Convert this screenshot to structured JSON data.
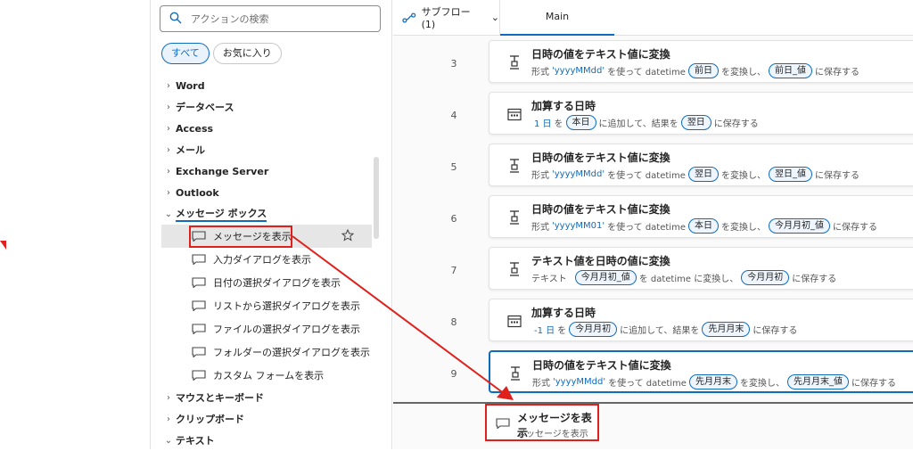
{
  "search": {
    "placeholder": "アクションの検索"
  },
  "filters": [
    {
      "label": "すべて"
    },
    {
      "label": "お気に入り"
    }
  ],
  "tree": {
    "top_categories": [
      "Word",
      "データベース",
      "Access",
      "メール",
      "Exchange Server",
      "Outlook"
    ],
    "expanded_category": "メッセージ ボックス",
    "actions": [
      "メッセージを表示",
      "入力ダイアログを表示",
      "日付の選択ダイアログを表示",
      "リストから選択ダイアログを表示",
      "ファイルの選択ダイアログを表示",
      "フォルダーの選択ダイアログを表示",
      "カスタム フォームを表示"
    ],
    "bottom_categories": [
      "マウスとキーボード",
      "クリップボード",
      "テキスト"
    ]
  },
  "header": {
    "subflow_label": "サブフロー (1)",
    "main_tab": "Main"
  },
  "steps": [
    {
      "num": "3",
      "title": "日時の値をテキスト値に変換",
      "icon": "convert-icon",
      "d1": "形式",
      "v1": "'yyyyMMdd'",
      "d2": "を使って datetime",
      "c1": "前日",
      "d3": "を変換し、",
      "c2": "前日_値",
      "d4": "に保存する"
    },
    {
      "num": "4",
      "title": "加算する日時",
      "icon": "calendar-icon",
      "d1": "",
      "v1": "1 日",
      "d2": "を",
      "c1": "本日",
      "d3": "に追加して、結果を",
      "c2": "翌日",
      "d4": "に保存する"
    },
    {
      "num": "5",
      "title": "日時の値をテキスト値に変換",
      "icon": "convert-icon",
      "d1": "形式",
      "v1": "'yyyyMMdd'",
      "d2": "を使って datetime",
      "c1": "翌日",
      "d3": "を変換し、",
      "c2": "翌日_値",
      "d4": "に保存する"
    },
    {
      "num": "6",
      "title": "日時の値をテキスト値に変換",
      "icon": "convert-icon",
      "d1": "形式",
      "v1": "'yyyyMM01'",
      "d2": "を使って datetime",
      "c1": "本日",
      "d3": "を変換し、",
      "c2": "今月月初_値",
      "d4": "に保存する"
    },
    {
      "num": "7",
      "title": "テキスト値を日時の値に変換",
      "icon": "convert-icon",
      "d1": "テキスト",
      "v1": "",
      "d2": "",
      "c1": "今月月初_値",
      "d3": "を datetime に変換し、",
      "c2": "今月月初",
      "d4": "に保存する"
    },
    {
      "num": "8",
      "title": "加算する日時",
      "icon": "calendar-icon",
      "d1": "",
      "v1": "-1 日",
      "d2": "を",
      "c1": "今月月初",
      "d3": "に追加して、結果を",
      "c2": "先月月末",
      "d4": "に保存する"
    },
    {
      "num": "9",
      "title": "日時の値をテキスト値に変換",
      "icon": "convert-icon",
      "d1": "形式",
      "v1": "'yyyyMMdd'",
      "d2": "を使って datetime",
      "c1": "先月月末",
      "d3": "を変換し、",
      "c2": "先月月末_値",
      "d4": "に保存する"
    }
  ],
  "drag_preview": {
    "title": "メッセージを表示",
    "subtitle": "メッセージを表示"
  },
  "colors": {
    "accent": "#0f6cbd",
    "highlight": "#e0201c"
  }
}
